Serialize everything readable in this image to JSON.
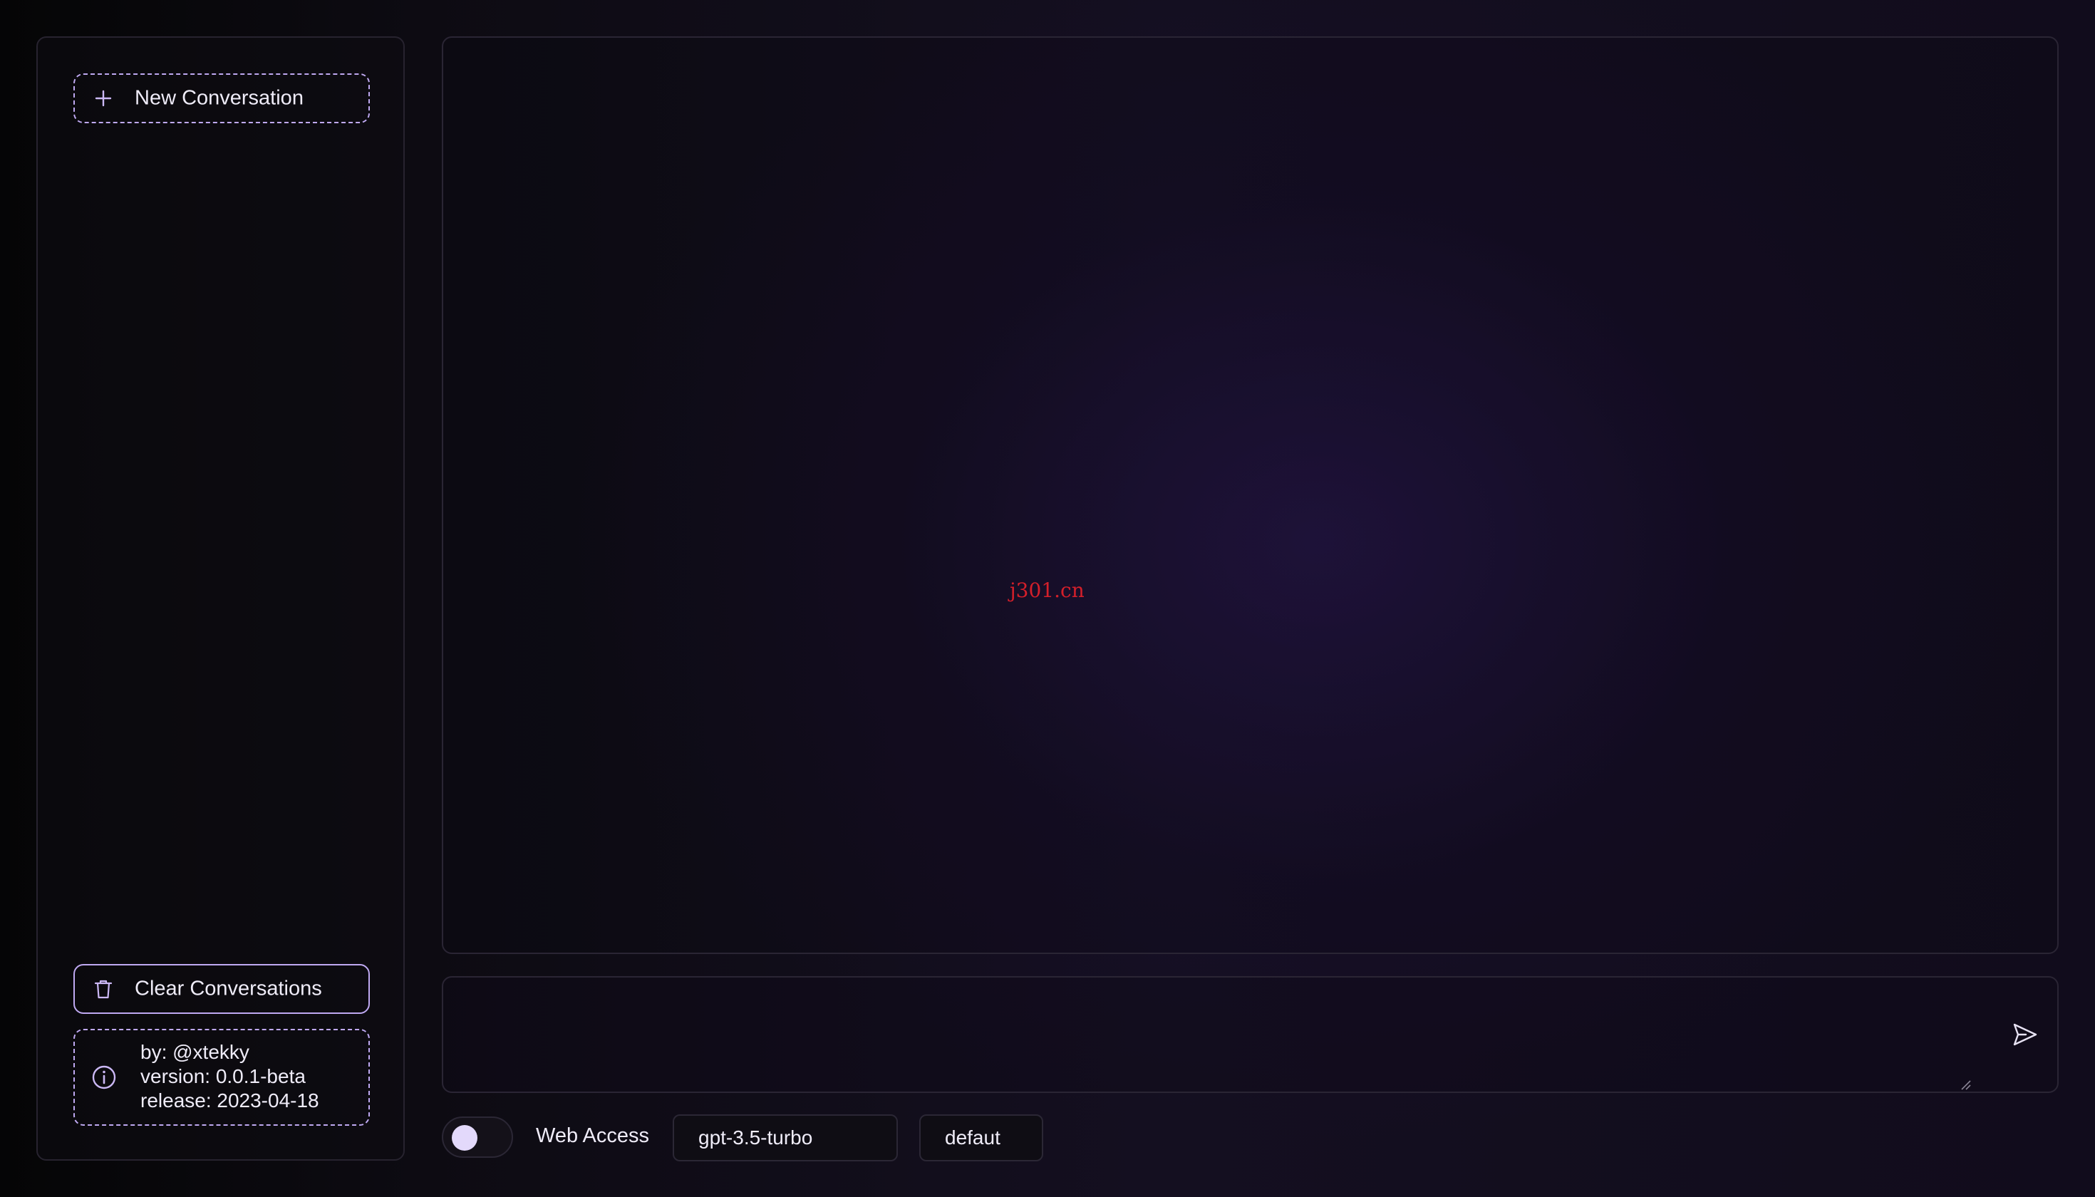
{
  "sidebar": {
    "new_conversation": {
      "label": "New Conversation",
      "icon": "plus-icon"
    },
    "clear_conversations": {
      "label": "Clear Conversations",
      "icon": "trash-icon"
    },
    "info": {
      "icon": "info-icon",
      "by": "by: @xtekky",
      "version": "version: 0.0.1-beta",
      "release": "release: 2023-04-18"
    }
  },
  "chat": {
    "watermark": "j301.cn"
  },
  "composer": {
    "message_value": "",
    "send_icon": "send-icon"
  },
  "footer": {
    "web_access_label": "Web Access",
    "web_access_enabled": false,
    "model_selected": "gpt-3.5-turbo",
    "prompt_selected": "defaut"
  },
  "colors": {
    "accent": "#bfa9f2",
    "knob": "#e3d9fb",
    "watermark": "#d41f2a",
    "background": "#140f20",
    "panel_border": "#2a2534"
  }
}
